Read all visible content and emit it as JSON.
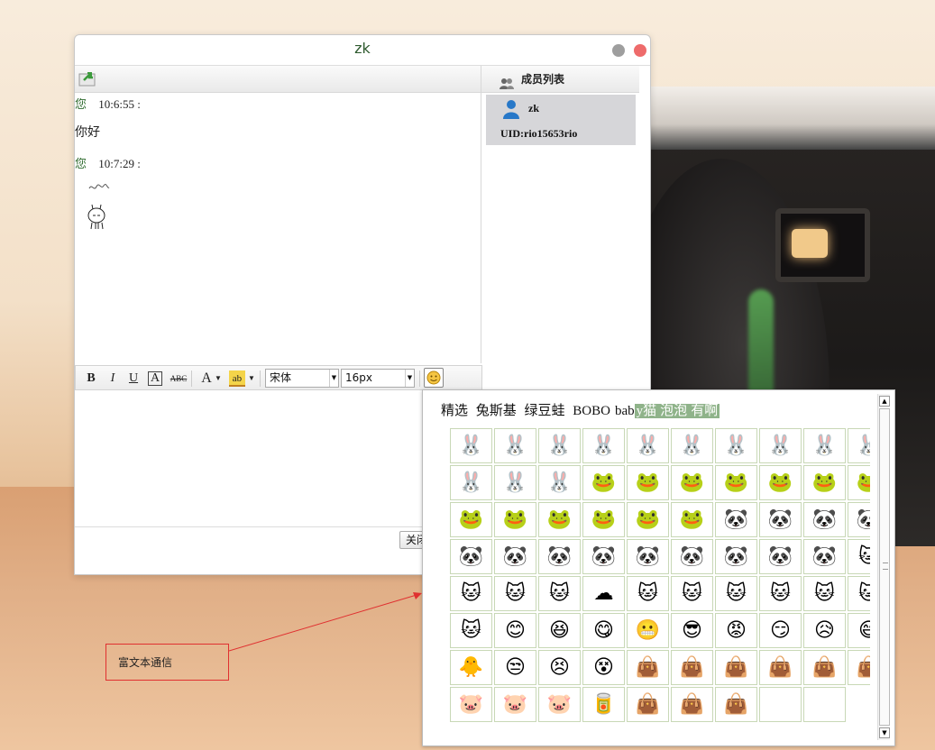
{
  "window": {
    "title": "zk"
  },
  "messages": [
    {
      "sender": "您",
      "time": "10:6:55 :",
      "text": "你好"
    },
    {
      "sender": "您",
      "time": "10:7:29 :",
      "text": ""
    }
  ],
  "members": {
    "header": "成员列表",
    "items": [
      {
        "name": "zk",
        "uid": "UID:rio15653rio"
      }
    ]
  },
  "format_bar": {
    "bold": "B",
    "italic": "I",
    "underline": "U",
    "fontcolor": "A",
    "strike": "ABC",
    "font_size_a": "A",
    "highlight": "ab",
    "font_family": "宋体",
    "font_size": "16px"
  },
  "close_button": "关闭",
  "emoji_panel": {
    "tabs": [
      "精选",
      "兔斯基",
      "绿豆蛙",
      "BOBO",
      "bab",
      "y猫",
      "泡泡",
      "有啊"
    ],
    "active_tabs": [
      "y猫",
      "泡泡",
      "有啊"
    ],
    "rows": [
      [
        "🐰",
        "🐰",
        "🐰",
        "🐰",
        "🐰",
        "🐰",
        "🐰",
        "🐰",
        "🐰",
        "🐰"
      ],
      [
        "🐰",
        "🐰",
        "🐰",
        "🐸",
        "🐸",
        "🐸",
        "🐸",
        "🐸",
        "🐸",
        "🐸"
      ],
      [
        "🐸",
        "🐸",
        "🐸",
        "🐸",
        "🐸",
        "🐸",
        "🐼",
        "🐼",
        "🐼",
        "🐼"
      ],
      [
        "🐼",
        "🐼",
        "🐼",
        "🐼",
        "🐼",
        "🐼",
        "🐼",
        "🐼",
        "🐼",
        "🐱"
      ],
      [
        "🐱",
        "🐱",
        "🐱",
        "☁",
        "🐱",
        "🐱",
        "🐱",
        "🐱",
        "🐱",
        "🐱"
      ],
      [
        "🐱",
        "😊",
        "😆",
        "😋",
        "😬",
        "😎",
        "😡",
        "😏",
        "😥",
        "😅"
      ],
      [
        "🐥",
        "😒",
        "😣",
        "😵",
        "👜",
        "👜",
        "👜",
        "👜",
        "👜",
        "👜"
      ],
      [
        "🐷",
        "🐷",
        "🐷",
        "🥫",
        "👜",
        "👜",
        "👜",
        "",
        ""
      ]
    ]
  },
  "annotation": {
    "text": "富文本通信"
  },
  "colors": {
    "accent_green": "#2e5a2e",
    "close_red": "#ee6b6b",
    "tab_highlight": "#8fb38a",
    "annotation_red": "#e03030"
  }
}
